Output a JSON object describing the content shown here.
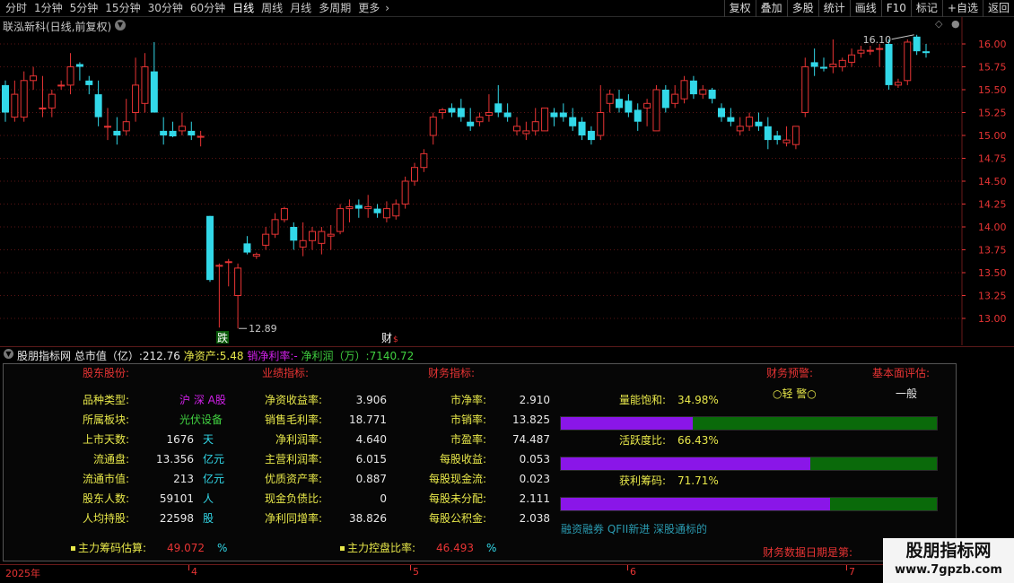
{
  "toolbar": {
    "periods": [
      "分时",
      "1分钟",
      "5分钟",
      "15分钟",
      "30分钟",
      "60分钟",
      "日线",
      "周线",
      "月线",
      "多周期",
      "更多"
    ],
    "more_icon": "chevron-right-icon",
    "tools": [
      "复权",
      "叠加",
      "多股",
      "统计",
      "画线",
      "F10",
      "标记",
      "+自选",
      "返回"
    ]
  },
  "stock_title": "联泓新科(日线,前复权)",
  "chart_data": {
    "type": "candlestick",
    "y_ticks": [
      "16.00",
      "15.75",
      "15.50",
      "15.25",
      "15.00",
      "14.75",
      "14.50",
      "14.25",
      "14.00",
      "13.75",
      "13.50",
      "13.25",
      "13.00"
    ],
    "ylim": [
      12.85,
      16.22
    ],
    "grid": true,
    "colors": {
      "up": "#e83434",
      "down": "#32d8e8",
      "grid": "#5a1414"
    },
    "candles": [
      {
        "o": 15.55,
        "h": 15.6,
        "l": 15.15,
        "c": 15.25
      },
      {
        "o": 15.2,
        "h": 15.6,
        "l": 15.15,
        "c": 15.45
      },
      {
        "o": 15.2,
        "h": 15.7,
        "l": 15.15,
        "c": 15.6
      },
      {
        "o": 15.6,
        "h": 15.75,
        "l": 15.5,
        "c": 15.65
      },
      {
        "o": 15.3,
        "h": 15.65,
        "l": 15.2,
        "c": 15.3
      },
      {
        "o": 15.3,
        "h": 15.5,
        "l": 15.2,
        "c": 15.45
      },
      {
        "o": 15.55,
        "h": 15.6,
        "l": 15.5,
        "c": 15.55
      },
      {
        "o": 15.55,
        "h": 15.9,
        "l": 15.45,
        "c": 15.75
      },
      {
        "o": 15.78,
        "h": 15.8,
        "l": 15.6,
        "c": 15.75
      },
      {
        "o": 15.6,
        "h": 15.65,
        "l": 15.45,
        "c": 15.55
      },
      {
        "o": 15.45,
        "h": 15.6,
        "l": 15.1,
        "c": 15.2
      },
      {
        "o": 15.1,
        "h": 15.3,
        "l": 14.95,
        "c": 15.1
      },
      {
        "o": 15.05,
        "h": 15.2,
        "l": 14.9,
        "c": 15.0
      },
      {
        "o": 15.05,
        "h": 15.4,
        "l": 15.0,
        "c": 15.15
      },
      {
        "o": 15.25,
        "h": 15.85,
        "l": 15.15,
        "c": 15.55
      },
      {
        "o": 15.35,
        "h": 15.9,
        "l": 15.25,
        "c": 15.75
      },
      {
        "o": 15.7,
        "h": 16.02,
        "l": 15.45,
        "c": 15.25
      },
      {
        "o": 15.05,
        "h": 15.2,
        "l": 14.9,
        "c": 15.0
      },
      {
        "o": 15.05,
        "h": 15.15,
        "l": 14.98,
        "c": 14.99
      },
      {
        "o": 15.05,
        "h": 15.25,
        "l": 15.0,
        "c": 15.1
      },
      {
        "o": 15.05,
        "h": 15.15,
        "l": 14.95,
        "c": 15.0
      },
      {
        "o": 14.98,
        "h": 15.05,
        "l": 14.88,
        "c": 14.99
      },
      {
        "o": 14.12,
        "h": 14.12,
        "l": 13.4,
        "c": 13.42
      },
      {
        "o": 13.58,
        "h": 13.6,
        "l": 12.9,
        "c": 13.58
      },
      {
        "o": 13.62,
        "h": 13.65,
        "l": 13.35,
        "c": 13.62
      },
      {
        "o": 13.25,
        "h": 13.6,
        "l": 12.89,
        "c": 13.55
      },
      {
        "o": 13.82,
        "h": 13.9,
        "l": 13.7,
        "c": 13.72
      },
      {
        "o": 13.68,
        "h": 13.72,
        "l": 13.65,
        "c": 13.7
      },
      {
        "o": 13.8,
        "h": 14.0,
        "l": 13.75,
        "c": 13.92
      },
      {
        "o": 13.92,
        "h": 14.15,
        "l": 13.88,
        "c": 14.08
      },
      {
        "o": 14.08,
        "h": 14.22,
        "l": 14.05,
        "c": 14.2
      },
      {
        "o": 14.0,
        "h": 14.05,
        "l": 13.75,
        "c": 13.85
      },
      {
        "o": 13.78,
        "h": 14.05,
        "l": 13.68,
        "c": 13.85
      },
      {
        "o": 13.85,
        "h": 14.0,
        "l": 13.75,
        "c": 13.95
      },
      {
        "o": 13.82,
        "h": 14.0,
        "l": 13.7,
        "c": 13.95
      },
      {
        "o": 13.9,
        "h": 14.02,
        "l": 13.75,
        "c": 13.92
      },
      {
        "o": 13.95,
        "h": 14.25,
        "l": 13.92,
        "c": 14.2
      },
      {
        "o": 14.2,
        "h": 14.3,
        "l": 14.05,
        "c": 14.22
      },
      {
        "o": 14.24,
        "h": 14.3,
        "l": 14.1,
        "c": 14.2
      },
      {
        "o": 14.2,
        "h": 14.35,
        "l": 14.1,
        "c": 14.22
      },
      {
        "o": 14.2,
        "h": 14.25,
        "l": 14.1,
        "c": 14.15
      },
      {
        "o": 14.1,
        "h": 14.28,
        "l": 14.05,
        "c": 14.2
      },
      {
        "o": 14.12,
        "h": 14.3,
        "l": 14.08,
        "c": 14.25
      },
      {
        "o": 14.25,
        "h": 14.55,
        "l": 14.2,
        "c": 14.5
      },
      {
        "o": 14.5,
        "h": 14.7,
        "l": 14.45,
        "c": 14.65
      },
      {
        "o": 14.65,
        "h": 14.85,
        "l": 14.6,
        "c": 14.8
      },
      {
        "o": 15.0,
        "h": 15.25,
        "l": 14.9,
        "c": 15.2
      },
      {
        "o": 15.25,
        "h": 15.3,
        "l": 15.18,
        "c": 15.28
      },
      {
        "o": 15.3,
        "h": 15.35,
        "l": 15.2,
        "c": 15.25
      },
      {
        "o": 15.3,
        "h": 15.4,
        "l": 15.15,
        "c": 15.2
      },
      {
        "o": 15.15,
        "h": 15.3,
        "l": 15.05,
        "c": 15.1
      },
      {
        "o": 15.15,
        "h": 15.25,
        "l": 15.1,
        "c": 15.2
      },
      {
        "o": 15.22,
        "h": 15.45,
        "l": 15.15,
        "c": 15.25
      },
      {
        "o": 15.35,
        "h": 15.55,
        "l": 15.2,
        "c": 15.25
      },
      {
        "o": 15.25,
        "h": 15.35,
        "l": 15.15,
        "c": 15.2
      },
      {
        "o": 15.05,
        "h": 15.2,
        "l": 15.0,
        "c": 15.1
      },
      {
        "o": 15.02,
        "h": 15.15,
        "l": 14.95,
        "c": 15.05
      },
      {
        "o": 15.05,
        "h": 15.3,
        "l": 15.0,
        "c": 15.15
      },
      {
        "o": 15.05,
        "h": 15.3,
        "l": 15.05,
        "c": 15.3
      },
      {
        "o": 15.25,
        "h": 15.3,
        "l": 15.1,
        "c": 15.2
      },
      {
        "o": 15.25,
        "h": 15.35,
        "l": 15.15,
        "c": 15.2
      },
      {
        "o": 15.2,
        "h": 15.3,
        "l": 15.05,
        "c": 15.1
      },
      {
        "o": 15.15,
        "h": 15.2,
        "l": 14.95,
        "c": 15.0
      },
      {
        "o": 15.05,
        "h": 15.1,
        "l": 14.9,
        "c": 14.95
      },
      {
        "o": 15.0,
        "h": 15.55,
        "l": 14.95,
        "c": 15.25
      },
      {
        "o": 15.35,
        "h": 15.5,
        "l": 15.25,
        "c": 15.45
      },
      {
        "o": 15.4,
        "h": 15.5,
        "l": 15.25,
        "c": 15.3
      },
      {
        "o": 15.38,
        "h": 15.45,
        "l": 15.2,
        "c": 15.25
      },
      {
        "o": 15.28,
        "h": 15.35,
        "l": 15.05,
        "c": 15.15
      },
      {
        "o": 15.3,
        "h": 15.4,
        "l": 15.1,
        "c": 15.35
      },
      {
        "o": 15.05,
        "h": 15.55,
        "l": 15.05,
        "c": 15.5
      },
      {
        "o": 15.5,
        "h": 15.55,
        "l": 15.25,
        "c": 15.3
      },
      {
        "o": 15.35,
        "h": 15.55,
        "l": 15.3,
        "c": 15.45
      },
      {
        "o": 15.4,
        "h": 15.65,
        "l": 15.35,
        "c": 15.6
      },
      {
        "o": 15.6,
        "h": 15.65,
        "l": 15.4,
        "c": 15.45
      },
      {
        "o": 15.45,
        "h": 15.55,
        "l": 15.4,
        "c": 15.5
      },
      {
        "o": 15.5,
        "h": 15.52,
        "l": 15.35,
        "c": 15.4
      },
      {
        "o": 15.3,
        "h": 15.35,
        "l": 15.15,
        "c": 15.2
      },
      {
        "o": 15.2,
        "h": 15.3,
        "l": 15.1,
        "c": 15.15
      },
      {
        "o": 15.05,
        "h": 15.2,
        "l": 15.0,
        "c": 15.1
      },
      {
        "o": 15.1,
        "h": 15.25,
        "l": 15.05,
        "c": 15.2
      },
      {
        "o": 15.15,
        "h": 15.25,
        "l": 15.05,
        "c": 15.1
      },
      {
        "o": 15.1,
        "h": 15.2,
        "l": 14.85,
        "c": 14.95
      },
      {
        "o": 15.0,
        "h": 15.05,
        "l": 14.9,
        "c": 14.95
      },
      {
        "o": 14.92,
        "h": 15.1,
        "l": 14.88,
        "c": 14.95
      },
      {
        "o": 14.9,
        "h": 15.1,
        "l": 14.85,
        "c": 15.1
      },
      {
        "o": 15.25,
        "h": 15.85,
        "l": 15.2,
        "c": 15.75
      },
      {
        "o": 15.8,
        "h": 15.95,
        "l": 15.65,
        "c": 15.75
      },
      {
        "o": 15.75,
        "h": 15.85,
        "l": 15.7,
        "c": 15.73
      },
      {
        "o": 15.75,
        "h": 16.05,
        "l": 15.68,
        "c": 15.78
      },
      {
        "o": 15.75,
        "h": 15.85,
        "l": 15.7,
        "c": 15.82
      },
      {
        "o": 15.8,
        "h": 15.95,
        "l": 15.75,
        "c": 15.88
      },
      {
        "o": 15.9,
        "h": 15.98,
        "l": 15.85,
        "c": 15.93
      },
      {
        "o": 15.92,
        "h": 15.98,
        "l": 15.88,
        "c": 15.93
      },
      {
        "o": 15.95,
        "h": 16.0,
        "l": 15.75,
        "c": 15.95
      },
      {
        "o": 16.0,
        "h": 16.05,
        "l": 15.5,
        "c": 15.55
      },
      {
        "o": 15.55,
        "h": 15.62,
        "l": 15.52,
        "c": 15.58
      },
      {
        "o": 15.6,
        "h": 16.05,
        "l": 15.55,
        "c": 16.02
      },
      {
        "o": 16.08,
        "h": 16.1,
        "l": 15.88,
        "c": 15.92
      },
      {
        "o": 15.92,
        "h": 16.0,
        "l": 15.85,
        "c": 15.9
      }
    ],
    "annotations": {
      "high_label": "16.10",
      "low_label": "12.89",
      "die_label": "跌",
      "cai_label": "财"
    }
  },
  "indicator_header": {
    "name": "股朋指标网",
    "total_mv_label": "总市值（亿）:",
    "total_mv": "212.76",
    "net_asset_label": "净资产:",
    "net_asset": "5.48",
    "net_margin_label": "销净利率:",
    "net_margin": "-",
    "net_profit_label": "净利润（万）:",
    "net_profit": "7140.72"
  },
  "panel": {
    "headers": {
      "shareholder": "股东股份:",
      "performance": "业绩指标:",
      "financial": "财务指标:",
      "warning": "财务预警:",
      "fundamental": "基本面评估:"
    },
    "shareholder": [
      {
        "label": "品种类型:",
        "value": "沪 深 A股",
        "unit": ""
      },
      {
        "label": "所属板块:",
        "value": "光伏设备",
        "unit": ""
      },
      {
        "label": "上市天数:",
        "value": "1676",
        "unit": "天"
      },
      {
        "label": "流通盘:",
        "value": "13.356",
        "unit": "亿元"
      },
      {
        "label": "流通市值:",
        "value": "213",
        "unit": "亿元"
      },
      {
        "label": "股东人数:",
        "value": "59101",
        "unit": "人"
      },
      {
        "label": "人均持股:",
        "value": "22598",
        "unit": "股"
      }
    ],
    "performance": [
      {
        "label": "净资收益率:",
        "value": "3.906"
      },
      {
        "label": "销售毛利率:",
        "value": "18.771"
      },
      {
        "label": "净利润率:",
        "value": "4.640"
      },
      {
        "label": "主营利润率:",
        "value": "6.015"
      },
      {
        "label": "优质资产率:",
        "value": "0.887"
      },
      {
        "label": "现金负债比:",
        "value": "0"
      },
      {
        "label": "净利同增率:",
        "value": "38.826"
      }
    ],
    "financial": [
      {
        "label": "市净率:",
        "value": "2.910"
      },
      {
        "label": "市销率:",
        "value": "13.825"
      },
      {
        "label": "市盈率:",
        "value": "74.487"
      },
      {
        "label": "每股收益:",
        "value": "0.053"
      },
      {
        "label": "每股现金流:",
        "value": "0.023"
      },
      {
        "label": "每股未分配:",
        "value": "2.111"
      },
      {
        "label": "每股公积金:",
        "value": "2.038"
      }
    ],
    "warning_value": "○轻 警○",
    "fundamental_value": "一般",
    "bars": [
      {
        "label": "量能饱和:",
        "value": "34.98%",
        "fraction": 0.3498
      },
      {
        "label": "活跃度比:",
        "value": "66.43%",
        "fraction": 0.6643
      },
      {
        "label": "获利筹码:",
        "value": "71.71%",
        "fraction": 0.7171
      }
    ],
    "concepts": "融资融券 QFII新进 深股通标的",
    "chip_estimate_label": "主力筹码估算:",
    "chip_estimate": "49.072",
    "chip_estimate_unit": "%",
    "control_label": "主力控盘比率:",
    "control": "46.493",
    "control_unit": "%",
    "report_date_label": "财务数据日期是第:"
  },
  "date_axis": {
    "labels": [
      "2025年",
      "4",
      "5",
      "6",
      "7"
    ]
  },
  "watermark": {
    "title": "股朋指标网",
    "url": "www.7gpzb.com"
  }
}
